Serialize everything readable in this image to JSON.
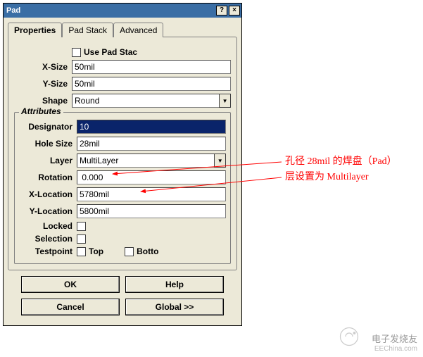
{
  "window": {
    "title": "Pad",
    "help_btn": "?",
    "close_btn": "×"
  },
  "tabs": {
    "properties": "Properties",
    "pad_stack": "Pad Stack",
    "advanced": "Advanced"
  },
  "fields": {
    "use_pad_stack_label": "Use Pad Stac",
    "x_size_label": "X-Size",
    "x_size_value": "50mil",
    "y_size_label": "Y-Size",
    "y_size_value": "50mil",
    "shape_label": "Shape",
    "shape_value": "Round"
  },
  "attributes": {
    "legend": "Attributes",
    "designator_label": "Designator",
    "designator_value": "10",
    "hole_size_label": "Hole Size",
    "hole_size_value": "28mil",
    "layer_label": "Layer",
    "layer_value": "MultiLayer",
    "rotation_label": "Rotation",
    "rotation_value": " 0.000",
    "x_location_label": "X-Location",
    "x_location_value": "5780mil",
    "y_location_label": "Y-Location",
    "y_location_value": "5800mil",
    "locked_label": "Locked",
    "selection_label": "Selection",
    "testpoint_label": "Testpoint",
    "testpoint_top": "Top",
    "testpoint_bottom": "Botto"
  },
  "buttons": {
    "ok": "OK",
    "help": "Help",
    "cancel": "Cancel",
    "global": "Global >>"
  },
  "annotations": {
    "line1": "孔径 28mil 的焊盘（Pad）",
    "line2": "层设置为 Multilayer"
  },
  "watermark": {
    "brand": "电子发烧友",
    "url": "EEChina.com"
  }
}
